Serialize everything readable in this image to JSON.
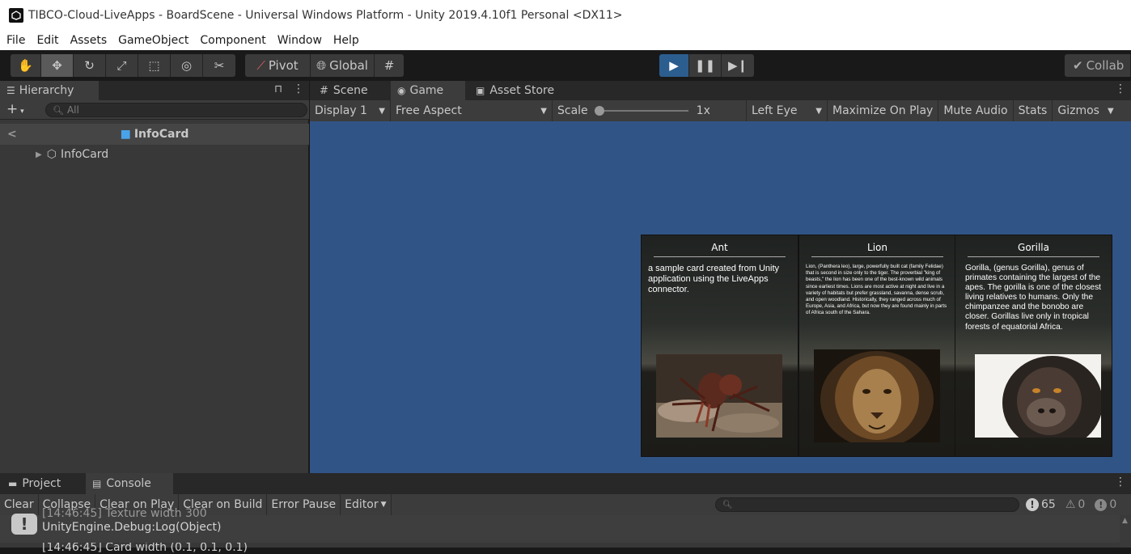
{
  "window": {
    "title": "TIBCO-Cloud-LiveApps - BoardScene - Universal Windows Platform - Unity 2019.4.10f1 Personal <DX11>"
  },
  "menu": [
    "File",
    "Edit",
    "Assets",
    "GameObject",
    "Component",
    "Window",
    "Help"
  ],
  "toolbar": {
    "pivot_label": "Pivot",
    "global_label": "Global",
    "collab_label": "Collab"
  },
  "hierarchy": {
    "tab_label": "Hierarchy",
    "search_placeholder": "All",
    "scene_header": "InfoCard",
    "item_label": "InfoCard"
  },
  "game_tabs": {
    "scene": "Scene",
    "game": "Game",
    "asset_store": "Asset Store"
  },
  "game_toolbar": {
    "display": "Display 1",
    "aspect": "Free Aspect",
    "scale_label": "Scale",
    "scale_value": "1x",
    "eye": "Left Eye",
    "maximize": "Maximize On Play",
    "mute": "Mute Audio",
    "stats": "Stats",
    "gizmos": "Gizmos"
  },
  "cards": [
    {
      "title": "Ant",
      "description": "a sample card created from Unity application using the LiveApps connector."
    },
    {
      "title": "Lion",
      "description": "Lion, (Panthera leo), large, powerfully built cat (family Felidae) that is second in size only to the tiger. The proverbial \"king of beasts,\" the lion has been one of the best-known wild animals since earliest times. Lions are most active at night and live in a variety of habitats but prefer grassland, savanna, dense scrub, and open woodland. Historically, they ranged across much of Europe, Asia, and Africa, but now they are found mainly in parts of Africa south of the Sahara."
    },
    {
      "title": "Gorilla",
      "description": "Gorilla, (genus Gorilla), genus of primates containing the largest of the apes. The gorilla is one of the closest living relatives to humans. Only the chimpanzee and the bonobo are closer. Gorillas live only in tropical forests of equatorial Africa."
    }
  ],
  "console": {
    "tabs": {
      "project": "Project",
      "console": "Console"
    },
    "buttons": {
      "clear": "Clear",
      "collapse": "Collapse",
      "clear_on_play": "Clear on Play",
      "clear_on_build": "Clear on Build",
      "error_pause": "Error Pause",
      "editor": "Editor"
    },
    "counts": {
      "logs": "65",
      "warnings": "0",
      "errors": "0"
    },
    "rows": [
      {
        "line1": "[14:46:45] Texture width 300",
        "line2": "UnityEngine.Debug:Log(Object)"
      },
      {
        "line1": "[14:46:45] Card width (0.1, 0.1, 0.1)"
      }
    ]
  }
}
